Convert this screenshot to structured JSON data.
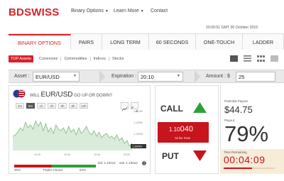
{
  "header": {
    "logo_bd": "BD",
    "logo_swiss": "SWISS",
    "nav": [
      "Binary Options",
      "Learn More",
      "Contact"
    ],
    "timestamp": "20:00:51 GMT 30 October 2015"
  },
  "tabs": [
    "BINARY OPTIONS",
    "PAIRS",
    "LONG TERM",
    "60 SECONDS",
    "ONE-TOUCH",
    "LADDER"
  ],
  "filters": {
    "top_assets": "TOP Assets",
    "items": [
      "Currencies",
      "Commodities",
      "Indices",
      "Stocks"
    ]
  },
  "controls": {
    "asset_label": "Asset :",
    "asset_value": "EUR/USD",
    "expiration_label": "Expiration :",
    "expiration_value": "20:10",
    "amount_label": "Amount : $",
    "amount_value": "25"
  },
  "chart": {
    "will": "WILL",
    "pair": "EUR/USD",
    "question": "GO UP OR DOWN?",
    "timeframes": [
      "2m",
      "5m",
      "1h",
      "2h",
      "6h",
      "8h",
      "12h"
    ],
    "active_timeframe": "5m",
    "y_ticks": [
      "1.10100",
      "1.10050",
      "1.10000",
      "1.09950"
    ],
    "x_ticks": [
      "19:15",
      "19:30",
      "19:45",
      "20:00"
    ],
    "current_price": "1.10040",
    "bid": "bid: 1.10014",
    "ask": "ask: 1.10044",
    "trader_choice_label": "Trader Choice",
    "trader_down_pct": "46%",
    "trader_up_pct": "54%",
    "trader_down_fraction": 0.46,
    "colors": {
      "up": "#2f9e3a",
      "down": "#c8141c"
    }
  },
  "trade": {
    "call_label": "CALL",
    "strike_big": "1.10",
    "strike_small": "040",
    "strike_label": "Strike Rate",
    "put_label": "PUT"
  },
  "payout": {
    "potential_label": "Potential Payout",
    "potential_value": "$44.75",
    "payout_label": "Payout",
    "payout_value": "79%",
    "time_label": "Time Remaining",
    "time_value": "00:04:09"
  }
}
